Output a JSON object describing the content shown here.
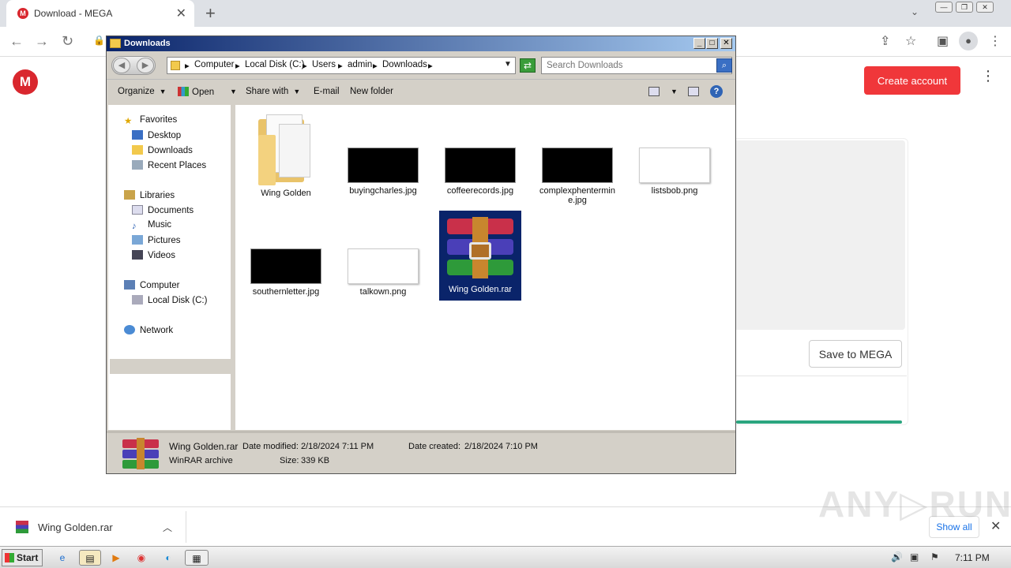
{
  "browser": {
    "tab_title": "Download - MEGA",
    "tab_close": "✕",
    "new_tab": "+"
  },
  "mega": {
    "logo": "M",
    "create_account": "Create account",
    "save_to_mega": "Save to MEGA",
    "accent_color": "#f0373a",
    "progress_color": "#2ba57f"
  },
  "explorer": {
    "title": "Downloads",
    "breadcrumbs": [
      "Computer",
      "Local Disk (C:)",
      "Users",
      "admin",
      "Downloads"
    ],
    "search_placeholder": "Search Downloads",
    "commands": {
      "organize": "Organize",
      "open": "Open",
      "share_with": "Share with",
      "email": "E-mail",
      "new_folder": "New folder"
    },
    "nav": {
      "favorites": "Favorites",
      "desktop": "Desktop",
      "downloads": "Downloads",
      "recent_places": "Recent Places",
      "libraries": "Libraries",
      "documents": "Documents",
      "music": "Music",
      "pictures": "Pictures",
      "videos": "Videos",
      "computer": "Computer",
      "local_disk": "Local Disk (C:)",
      "network": "Network"
    },
    "files": [
      {
        "name": "Wing Golden",
        "type": "folder"
      },
      {
        "name": "buyingcharles.jpg",
        "type": "black-image"
      },
      {
        "name": "coffeerecords.jpg",
        "type": "black-image"
      },
      {
        "name": "complexphentermine.jpg",
        "type": "black-image"
      },
      {
        "name": "listsbob.png",
        "type": "white-image"
      },
      {
        "name": "southernletter.jpg",
        "type": "black-image"
      },
      {
        "name": "talkown.png",
        "type": "white-image"
      },
      {
        "name": "Wing Golden.rar",
        "type": "rar",
        "selected": true
      }
    ],
    "details": {
      "name": "Wing Golden.rar",
      "type": "WinRAR archive",
      "date_modified_label": "Date modified:",
      "date_modified": "2/18/2024 7:11 PM",
      "date_created_label": "Date created:",
      "date_created": "2/18/2024 7:10 PM",
      "size_label": "Size:",
      "size": "339 KB"
    }
  },
  "download_shelf": {
    "item_name": "Wing Golden.rar",
    "show_all": "Show all"
  },
  "watermark": "ANY▷RUN",
  "taskbar": {
    "start": "Start",
    "time": "7:11 PM"
  }
}
